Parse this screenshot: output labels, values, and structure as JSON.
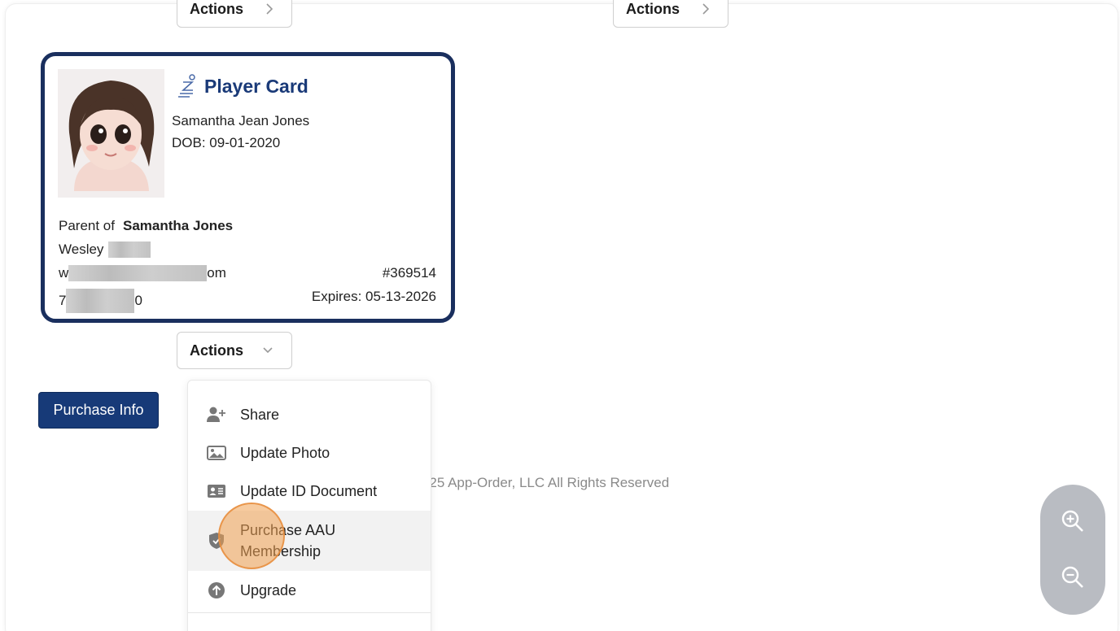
{
  "top_actions": [
    {
      "label": "Actions"
    },
    {
      "label": "Actions"
    }
  ],
  "card": {
    "title": "Player Card",
    "player_name": "Samantha Jean Jones",
    "dob": "DOB: 09-01-2020",
    "parent_prefix": "Parent of",
    "parent_child_name": "Samantha Jones",
    "guardian_name": "Wesley",
    "email_start": "w",
    "email_end": "om",
    "phone_start": "7",
    "phone_end": "0",
    "member_id": "#369514",
    "expires": "Expires: 05-13-2026"
  },
  "card_actions": {
    "label": "Actions"
  },
  "purchase_info": {
    "label": "Purchase Info"
  },
  "footer": {
    "text": "013 - 2025 App-Order, LLC All Rights Reserved"
  },
  "menu": {
    "items": [
      {
        "label": "Share",
        "icon": "user-plus-icon"
      },
      {
        "label": "Update Photo",
        "icon": "image-icon"
      },
      {
        "label": "Update ID Document",
        "icon": "id-card-icon"
      },
      {
        "label": "Purchase AAU",
        "label_line2": "Membership",
        "icon": "shield-icon"
      },
      {
        "label": "Upgrade",
        "icon": "arrow-up-circle-icon"
      }
    ]
  },
  "colors": {
    "brand_navy": "#1a2f5e",
    "title_blue": "#1a3a78",
    "button_blue": "#173a78",
    "highlight_orange": "#f0a050",
    "zoom_panel_gray": "#b9bcc2"
  }
}
